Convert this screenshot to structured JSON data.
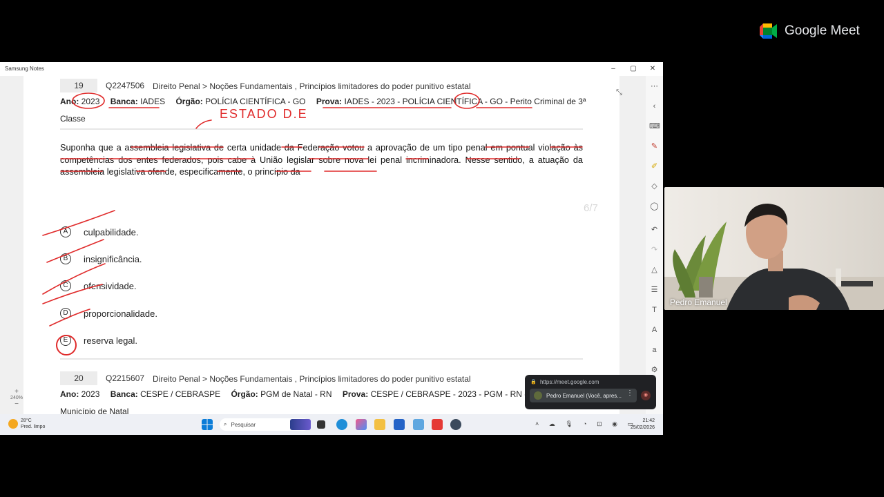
{
  "meet": {
    "brand_name": "Google Meet"
  },
  "window": {
    "title": "Samsung Notes",
    "controls": {
      "minimize": "–",
      "maximize": "▢",
      "close": "✕"
    }
  },
  "q19": {
    "number": "19",
    "code": "Q2247506",
    "path": "Direito Penal > Noções Fundamentais , Princípios limitadores do poder punitivo estatal",
    "ano_label": "Ano:",
    "ano": "2023",
    "banca_label": "Banca:",
    "banca": "IADES",
    "orgao_label": "Órgão:",
    "orgao": "POLÍCIA CIENTÍFICA - GO",
    "prova_label": "Prova:",
    "prova": "IADES - 2023 - POLÍCIA CIENTÍFICA - GO - Perito Criminal de 3ª",
    "prova_cont": "Classe",
    "stem": "Suponha que a assembleia legislativa de certa unidade da Federação votou a aprovação de um tipo penal em pontual violação às competências dos entes federados, pois cabe à União legislar sobre nova lei penal incriminadora. Nesse sentido, a atuação da assembleia legislativa ofende, especificamente, o princípio da",
    "page_counter": "6/7",
    "options": [
      {
        "letter": "A",
        "text": "culpabilidade."
      },
      {
        "letter": "B",
        "text": "insignificância."
      },
      {
        "letter": "C",
        "text": "ofensividade."
      },
      {
        "letter": "D",
        "text": "proporcionalidade."
      },
      {
        "letter": "E",
        "text": "reserva legal."
      }
    ]
  },
  "q20": {
    "number": "20",
    "code": "Q2215607",
    "path": "Direito Penal > Noções Fundamentais , Princípios limitadores do poder punitivo estatal",
    "ano_label": "Ano:",
    "ano": "2023",
    "banca_label": "Banca:",
    "banca": "CESPE / CEBRASPE",
    "orgao_label": "Órgão:",
    "orgao": "PGM de Natal - RN",
    "prova_label": "Prova:",
    "prova": "CESPE / CEBRASPE - 2023 - PGM - RN - Procurad",
    "prova_cont": "Município de Natal"
  },
  "handwriting": {
    "annotation": "ESTADO   D.E"
  },
  "zoom": {
    "plus": "+",
    "level": "240%",
    "minus": "−"
  },
  "taskbar": {
    "temp": "28°C",
    "condition": "Pred. limpo",
    "search_placeholder": "Pesquisar",
    "time": "21:42",
    "date": "25/02/2026"
  },
  "meet_chip": {
    "url": "https://meet.google.com",
    "presenter": "Pedro Emanuel (Você, apres..."
  },
  "participant": {
    "name": "Pedro Emanuel"
  },
  "colors": {
    "ink": "#e02b2b",
    "accent_red": "#e03030"
  }
}
